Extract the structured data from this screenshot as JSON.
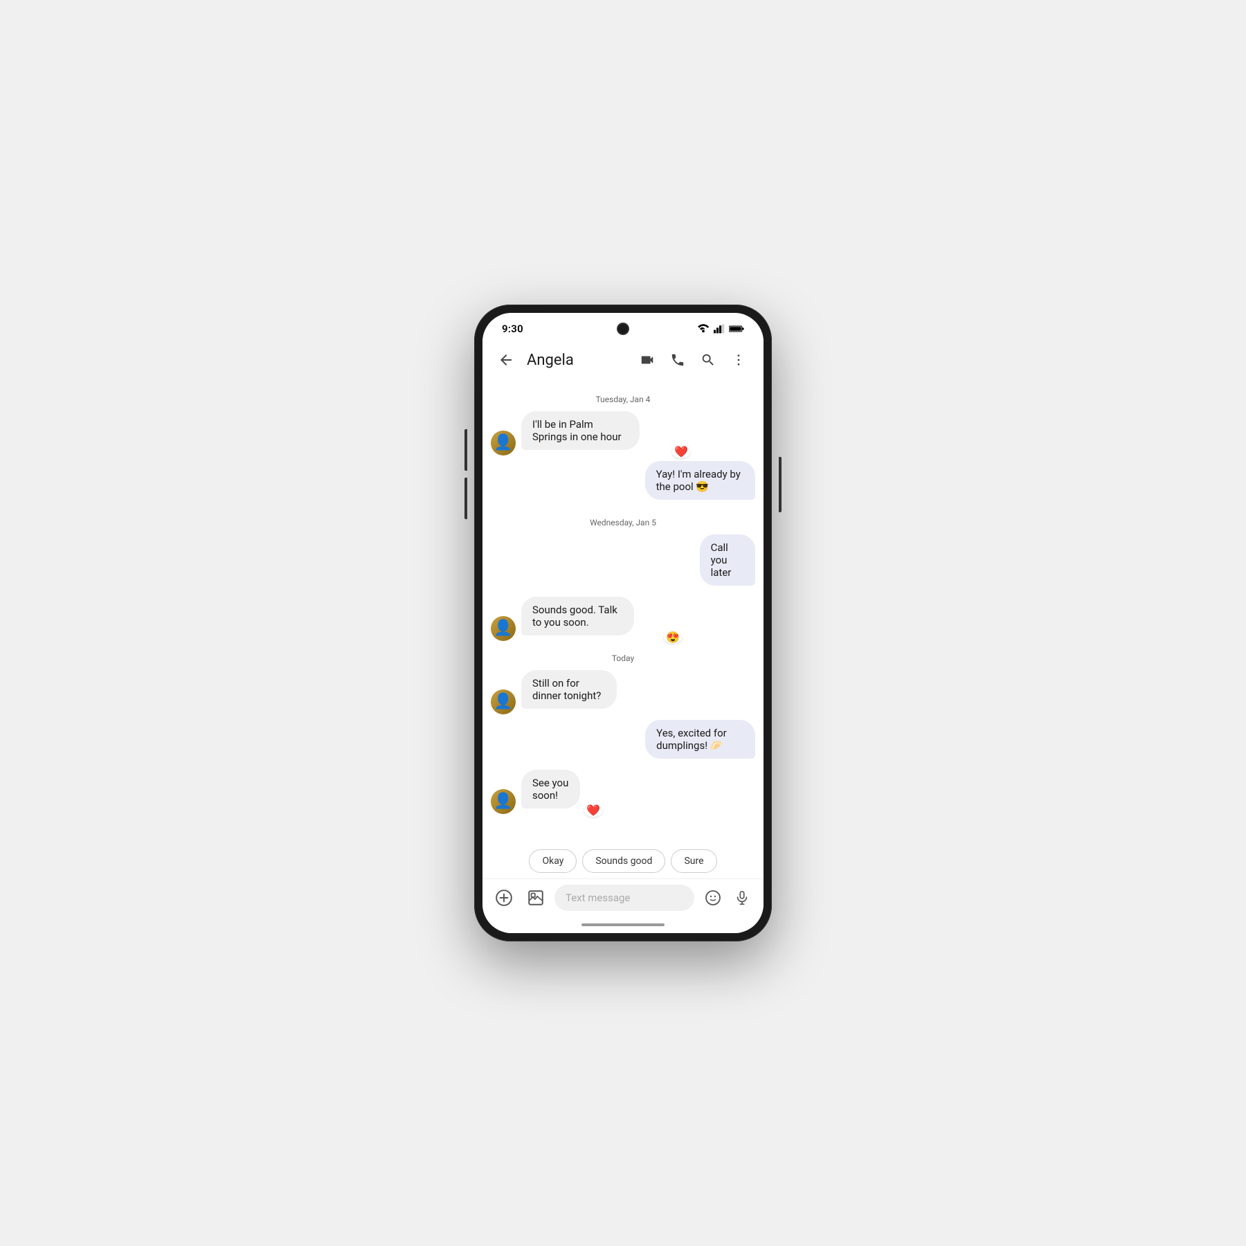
{
  "phone": {
    "status_bar": {
      "time": "9:30"
    },
    "header": {
      "contact_name": "Angela",
      "back_label": "back",
      "video_call_label": "video call",
      "phone_call_label": "phone call",
      "search_label": "search",
      "more_label": "more options"
    },
    "messages": [
      {
        "id": "date1",
        "type": "date",
        "text": "Tuesday, Jan 4"
      },
      {
        "id": "msg1",
        "type": "received",
        "text": "I'll be in Palm Springs in one hour",
        "reaction": "❤️"
      },
      {
        "id": "msg2",
        "type": "sent",
        "text": "Yay! I'm already by the pool 😎"
      },
      {
        "id": "date2",
        "type": "date",
        "text": "Wednesday, Jan 5"
      },
      {
        "id": "msg3",
        "type": "sent",
        "text": "Call you later"
      },
      {
        "id": "msg4",
        "type": "received",
        "text": "Sounds good. Talk to you soon.",
        "reaction": "😍"
      },
      {
        "id": "date3",
        "type": "date",
        "text": "Today"
      },
      {
        "id": "msg5",
        "type": "received",
        "text": "Still on for dinner tonight?"
      },
      {
        "id": "msg6",
        "type": "sent",
        "text": "Yes, excited for dumplings! 🥟"
      },
      {
        "id": "msg7",
        "type": "received",
        "text": "See you soon!",
        "reaction": "❤️"
      }
    ],
    "smart_replies": [
      {
        "label": "Okay"
      },
      {
        "label": "Sounds good"
      },
      {
        "label": "Sure"
      }
    ],
    "input_bar": {
      "placeholder": "Text message"
    }
  }
}
